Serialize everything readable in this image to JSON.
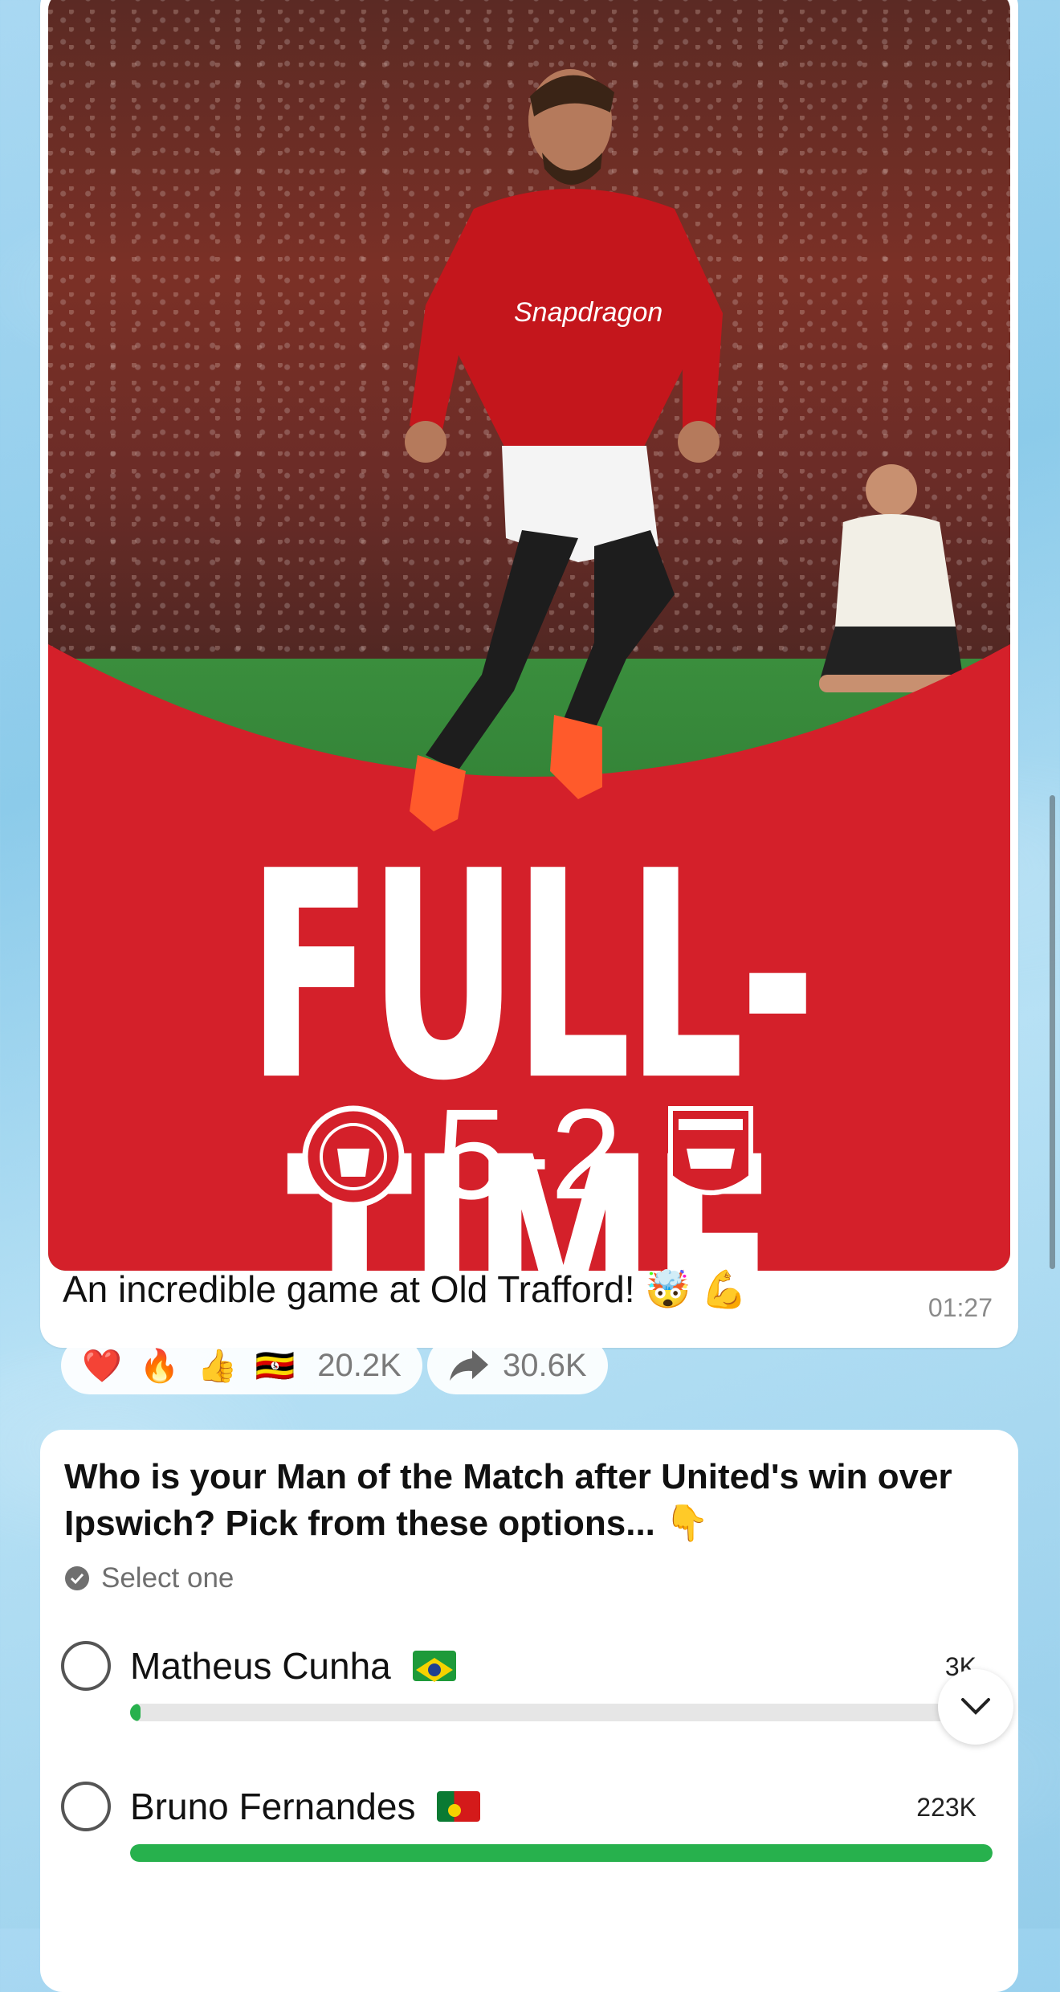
{
  "message": {
    "image_alt": "Bruno Fernandes celebrating — FULL-TIME 5-2",
    "graphic_title": "FULL-TIME",
    "score": "5-2",
    "home_crest_text": "MANCHESTER UNITED",
    "away_crest_text": "IPSWICH TOWN FOOTBALL CLUB",
    "caption": "An incredible game at Old Trafford! 🤯 💪",
    "time": "01:27"
  },
  "reactions": {
    "emojis": [
      "❤️",
      "🔥",
      "👍",
      "🇺🇬"
    ],
    "count": "20.2K",
    "shares_count": "30.6K"
  },
  "poll": {
    "question": "Who is your Man of the Match after United's win over Ipswich? Pick from these options... 👇",
    "mode": "Select one",
    "options": [
      {
        "label": "Matheus Cunha",
        "flag": "Brazil",
        "count": "3K",
        "fraction": 0.012
      },
      {
        "label": "Bruno Fernandes",
        "flag": "Portugal",
        "count": "223K",
        "fraction": 1.0
      }
    ]
  },
  "colors": {
    "accent_green": "#27b14d",
    "united_red": "#d4202a"
  }
}
